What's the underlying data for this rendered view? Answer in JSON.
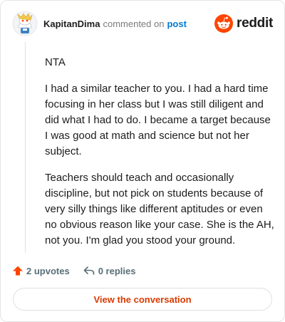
{
  "header": {
    "username": "KapitanDima",
    "action_text": "commented on",
    "target_text": "post",
    "logo_text": "reddit"
  },
  "comment": {
    "paragraphs": [
      "NTA",
      "I had a similar teacher to you. I had a hard time focusing in her class but I was still diligent and did what I had to do. I became a target because I was good at math and science but not her subject.",
      "Teachers should teach and occasionally discipline, but not pick on students because of very silly things like different aptitudes or even no obvious reason like your case. She is the AH, not you. I'm glad you stood your ground."
    ]
  },
  "footer": {
    "upvotes_label": "2 upvotes",
    "replies_label": "0 replies",
    "upvote_icon": "upvote-arrow-icon",
    "reply_icon": "reply-arrow-icon"
  },
  "cta": {
    "label": "View the conversation"
  },
  "colors": {
    "brand": "#ff4500",
    "link": "#0079d3",
    "cta_text": "#d93a00",
    "muted": "#576f76"
  }
}
